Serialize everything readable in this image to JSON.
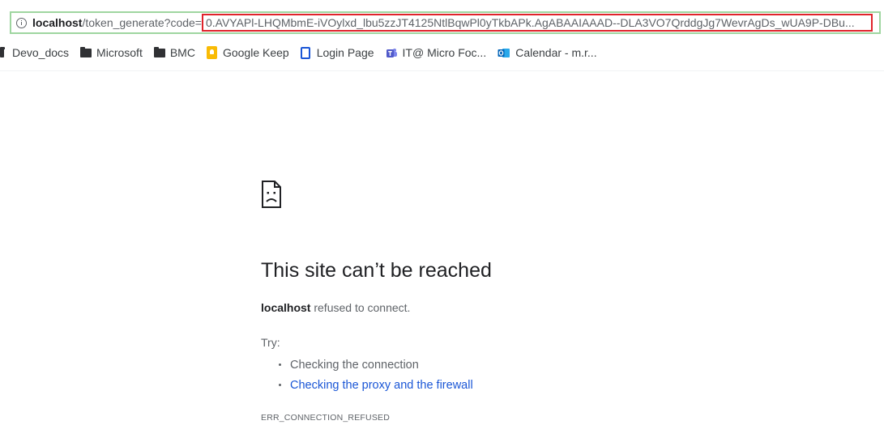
{
  "address_bar": {
    "host": "localhost",
    "path": "/token_generate?code=",
    "code_value": "0.AVYAPl-LHQMbmE-iVOylxd_lbu5zzJT4125NtlBqwPl0yTkbAPk.AgABAAIAAAD--DLA3VO7QrddgJg7WevrAgDs_wUA9P-DBu..."
  },
  "bookmarks": [
    {
      "label": "Devo_docs",
      "icon": "folder-icon"
    },
    {
      "label": "Microsoft",
      "icon": "folder-icon"
    },
    {
      "label": "BMC",
      "icon": "folder-icon"
    },
    {
      "label": "Google Keep",
      "icon": "google-keep-icon"
    },
    {
      "label": "Login Page",
      "icon": "login-page-icon"
    },
    {
      "label": "IT@ Micro Foc...",
      "icon": "teams-icon"
    },
    {
      "label": "Calendar - m.r...",
      "icon": "outlook-icon"
    }
  ],
  "error": {
    "icon": "sad-page-icon",
    "title": "This site can’t be reached",
    "host": "localhost",
    "message": " refused to connect.",
    "try_label": "Try:",
    "suggestions": [
      "Checking the connection",
      "Checking the proxy and the firewall"
    ],
    "code": "ERR_CONNECTION_REFUSED"
  },
  "colors": {
    "address_border": "#9fd6a0",
    "highlight_border": "#e0232b",
    "link": "#1a56d6",
    "keep": "#f9bb05"
  }
}
